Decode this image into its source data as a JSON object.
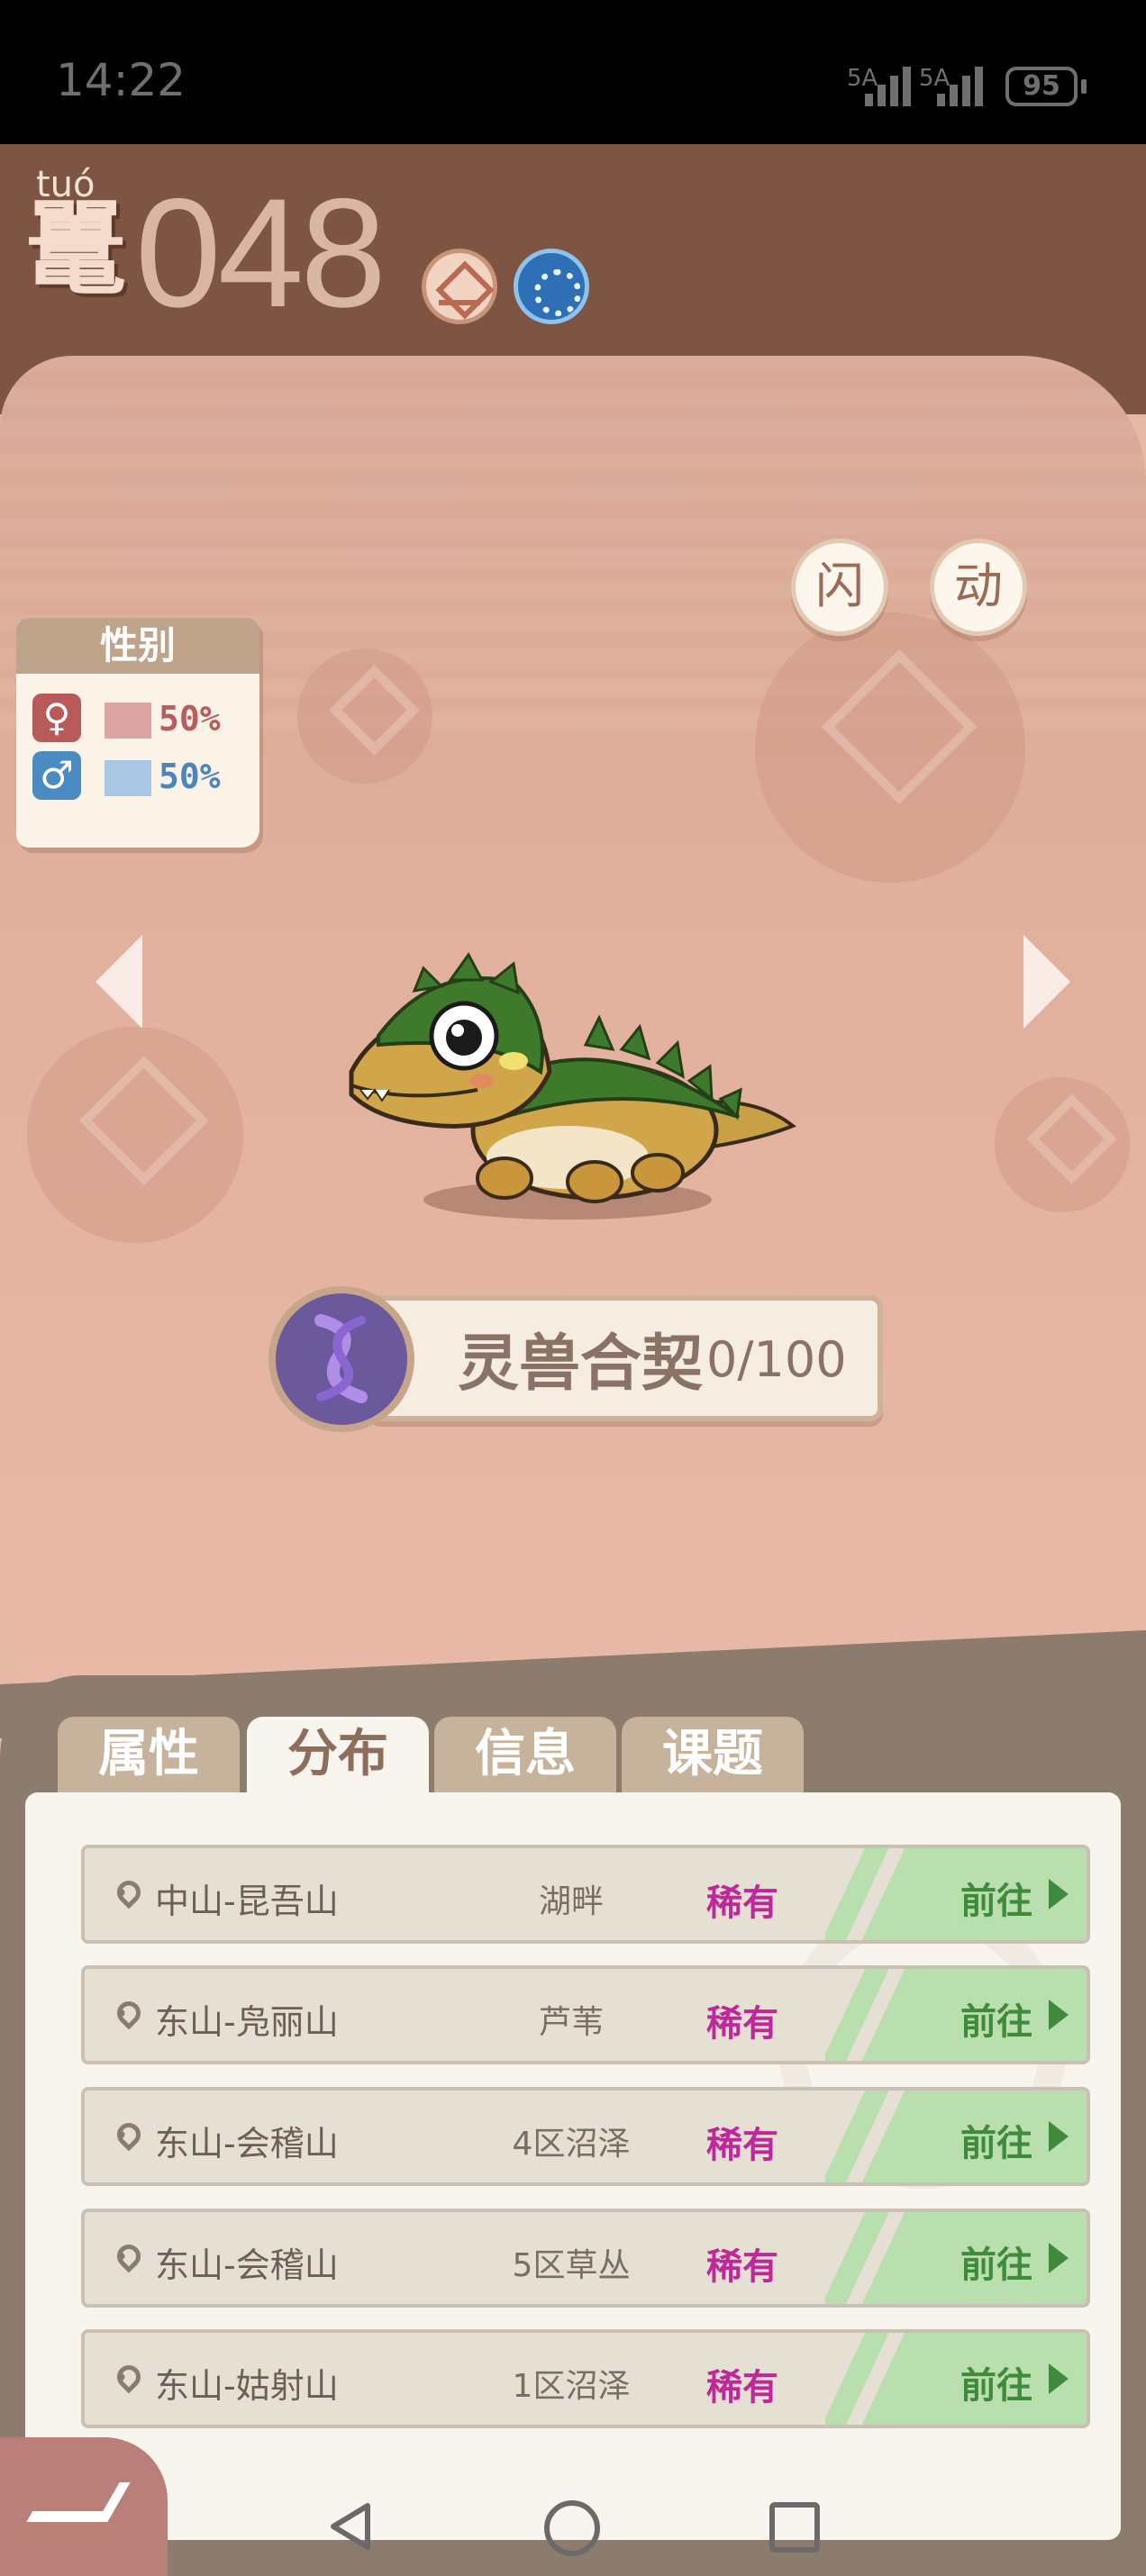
{
  "status_bar": {
    "time": "14:22",
    "signal_1": "5A",
    "signal_2": "5A",
    "battery": "95"
  },
  "header": {
    "pinyin": "tuó",
    "name_char": "鼍",
    "dex_number": "048",
    "types": [
      "earth-type-icon",
      "water-type-icon"
    ]
  },
  "gender": {
    "title": "性别",
    "female": {
      "symbol": "♀",
      "percent": "50%"
    },
    "male": {
      "symbol": "♂",
      "percent": "50%"
    }
  },
  "actions": {
    "shiny_label": "闪",
    "animate_label": "动"
  },
  "contract": {
    "label": "灵兽合契",
    "progress": "0/100"
  },
  "tabs": [
    {
      "label": "属性",
      "active": false
    },
    {
      "label": "分布",
      "active": true
    },
    {
      "label": "信息",
      "active": false
    },
    {
      "label": "课题",
      "active": false
    }
  ],
  "locations": [
    {
      "place": "中山-昆吾山",
      "terrain": "湖畔",
      "rarity": "稀有",
      "action": "前往"
    },
    {
      "place": "东山-凫丽山",
      "terrain": "芦苇",
      "rarity": "稀有",
      "action": "前往"
    },
    {
      "place": "东山-会稽山",
      "terrain": "4区沼泽",
      "rarity": "稀有",
      "action": "前往"
    },
    {
      "place": "东山-会稽山",
      "terrain": "5区草丛",
      "rarity": "稀有",
      "action": "前往"
    },
    {
      "place": "东山-姑射山",
      "terrain": "1区沼泽",
      "rarity": "稀有",
      "action": "前往"
    }
  ],
  "colors": {
    "header": "#7e5442",
    "rarity": "#c0289a",
    "go": "#3f8a3d"
  }
}
